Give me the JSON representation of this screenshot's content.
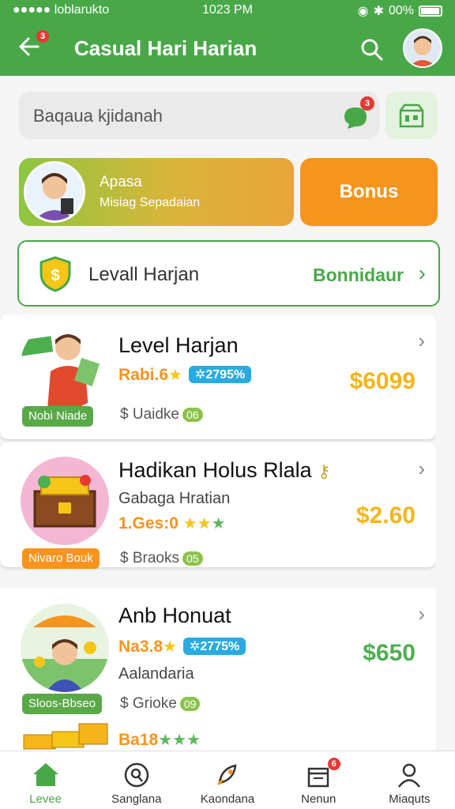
{
  "status": {
    "carrier": "●●●●● loblarukto",
    "time": "1023 PM",
    "battery": "00%",
    "battery_level": 0.9
  },
  "header": {
    "back_badge": "3",
    "title": "Casual Hari Harian"
  },
  "search": {
    "placeholder": "Baqaua kjidanah",
    "chat_badge": "3"
  },
  "promo": {
    "title": "Apasa",
    "subtitle": "Misiag Sepadaian",
    "bonus_label": "Bonus"
  },
  "level": {
    "title": "Levall Harjan",
    "link": "Bonnidaur"
  },
  "items": [
    {
      "title": "Level Harjan",
      "tag": "Nobi Niade",
      "tag_color": "#5aa949",
      "rating": "Rabi.6",
      "pct": "✲2795%",
      "meta_label": "$ Uaidke",
      "meta_badge": "06",
      "price": "$6099",
      "price_color": "#f5b51b"
    },
    {
      "title": "Hadikan Holus Rlala",
      "subtitle": "Gabaga Hratian",
      "tag": "Nivaro Bouk",
      "tag_color": "#f7941d",
      "rating": "1.Ges:0",
      "meta_label": "$ Braoks",
      "meta_badge": "05",
      "price": "$2.60",
      "price_color": "#f5b51b"
    },
    {
      "title": "Anb Honuat",
      "subtitle": "Aalandaria",
      "tag": "Sloos-Bbseo",
      "tag_color": "#5aa949",
      "rating": "Na3.8",
      "pct": "✲2775%",
      "meta_label": "$ Grioke",
      "meta_badge": "09",
      "price": "$650",
      "price_color": "#4caf50"
    }
  ],
  "partial_item": {
    "rating": "Ba18"
  },
  "bottom_nav": [
    {
      "label": "Levee",
      "icon": "home-icon",
      "active": true
    },
    {
      "label": "Sanglana",
      "icon": "search-icon"
    },
    {
      "label": "Kaondana",
      "icon": "rocket-icon"
    },
    {
      "label": "Nenun",
      "icon": "gift-icon",
      "badge": "6"
    },
    {
      "label": "Miaquts",
      "icon": "profile-icon"
    }
  ],
  "colors": {
    "primary": "#48a848",
    "orange": "#f7941d",
    "gold": "#f5b51b",
    "blue": "#29abe2"
  }
}
